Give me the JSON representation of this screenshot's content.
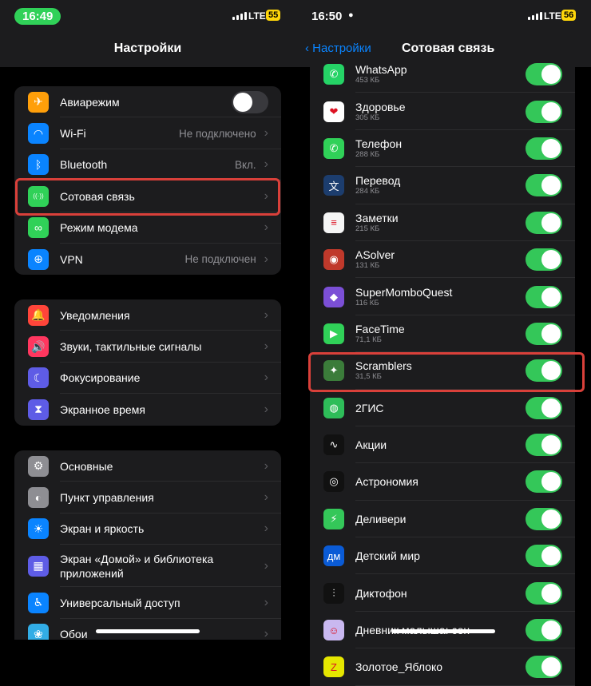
{
  "left": {
    "status": {
      "time": "16:49",
      "network": "LTE",
      "battery": "55"
    },
    "nav_title": "Настройки",
    "group1": [
      {
        "label": "Авиарежим",
        "value": "",
        "icon": "airplane-icon",
        "color": "#ff9f0a",
        "glyph": "✈",
        "toggle": "off"
      },
      {
        "label": "Wi‑Fi",
        "value": "Не подключено",
        "icon": "wifi-icon",
        "color": "#0a84ff",
        "glyph": "◠"
      },
      {
        "label": "Bluetooth",
        "value": "Вкл.",
        "icon": "bluetooth-icon",
        "color": "#0a84ff",
        "glyph": "ᛒ"
      },
      {
        "label": "Сотовая связь",
        "value": "",
        "icon": "cellular-icon",
        "color": "#30d158",
        "glyph": "((·))"
      },
      {
        "label": "Режим модема",
        "value": "",
        "icon": "hotspot-icon",
        "color": "#30d158",
        "glyph": "∞"
      },
      {
        "label": "VPN",
        "value": "Не подключен",
        "icon": "vpn-icon",
        "color": "#0a84ff",
        "glyph": "⊕"
      }
    ],
    "group2": [
      {
        "label": "Уведомления",
        "icon": "notifications-icon",
        "color": "#ff453a",
        "glyph": "🔔"
      },
      {
        "label": "Звуки, тактильные сигналы",
        "icon": "sounds-icon",
        "color": "#ff375f",
        "glyph": "🔊"
      },
      {
        "label": "Фокусирование",
        "icon": "focus-moon-icon",
        "color": "#5e5ce6",
        "glyph": "☾"
      },
      {
        "label": "Экранное время",
        "icon": "hourglass-icon",
        "color": "#5e5ce6",
        "glyph": "⧗"
      }
    ],
    "group3": [
      {
        "label": "Основные",
        "icon": "gear-icon",
        "color": "#8e8e93",
        "glyph": "⚙"
      },
      {
        "label": "Пункт управления",
        "icon": "control-center-icon",
        "color": "#8e8e93",
        "glyph": "◐"
      },
      {
        "label": "Экран и яркость",
        "icon": "brightness-icon",
        "color": "#0a84ff",
        "glyph": "☀"
      },
      {
        "label": "Экран «Домой» и библиотека приложений",
        "icon": "home-screen-icon",
        "color": "#5e5ce6",
        "glyph": "▦",
        "tall": true
      },
      {
        "label": "Универсальный доступ",
        "icon": "accessibility-icon",
        "color": "#0a84ff",
        "glyph": "♿"
      },
      {
        "label": "Обои",
        "icon": "wallpaper-icon",
        "color": "#32ade6",
        "glyph": "❀"
      }
    ]
  },
  "right": {
    "status": {
      "time": "16:50",
      "network": "LTE",
      "battery": "56"
    },
    "back_label": "Настройки",
    "nav_title": "Сотовая связь",
    "apps": [
      {
        "name": "WhatsApp",
        "size": "453 КБ",
        "icon": "whatsapp-icon",
        "color": "#25d366",
        "glyph": "✆"
      },
      {
        "name": "Здоровье",
        "size": "305 КБ",
        "icon": "health-heart-icon",
        "color": "#ffffff",
        "glyph": "❤"
      },
      {
        "name": "Телефон",
        "size": "288 КБ",
        "icon": "phone-icon",
        "color": "#30d158",
        "glyph": "✆"
      },
      {
        "name": "Перевод",
        "size": "284 КБ",
        "icon": "translate-icon",
        "color": "#1c3d6e",
        "glyph": "文"
      },
      {
        "name": "Заметки",
        "size": "215 КБ",
        "icon": "notes-icon",
        "color": "#f5f5f5",
        "glyph": "≡"
      },
      {
        "name": "ASolver",
        "size": "131 КБ",
        "icon": "asolver-icon",
        "color": "#c0392b",
        "glyph": "◉"
      },
      {
        "name": "SuperMomboQuest",
        "size": "116 КБ",
        "icon": "supermomboquest-icon",
        "color": "#7b4fd6",
        "glyph": "◆"
      },
      {
        "name": "FaceTime",
        "size": "71,1 КБ",
        "icon": "facetime-icon",
        "color": "#30d158",
        "glyph": "▶"
      },
      {
        "name": "Scramblers",
        "size": "31,5 КБ",
        "icon": "scramblers-icon",
        "color": "#3b7c3a",
        "glyph": "✦"
      },
      {
        "name": "2ГИС",
        "size": "",
        "icon": "2gis-icon",
        "color": "#2ebd59",
        "glyph": "◍"
      },
      {
        "name": "Акции",
        "size": "",
        "icon": "stocks-icon",
        "color": "#111111",
        "glyph": "∿"
      },
      {
        "name": "Астрономия",
        "size": "",
        "icon": "astronomy-icon",
        "color": "#111111",
        "glyph": "◎"
      },
      {
        "name": "Деливери",
        "size": "",
        "icon": "delivery-icon",
        "color": "#34c759",
        "glyph": "⚡"
      },
      {
        "name": "Детский мир",
        "size": "",
        "icon": "detsky-mir-icon",
        "color": "#0a5bd6",
        "glyph": "дм"
      },
      {
        "name": "Диктофон",
        "size": "",
        "icon": "voice-memos-icon",
        "color": "#111111",
        "glyph": "⫶"
      },
      {
        "name": "Дневник малыша: сон",
        "size": "",
        "icon": "baby-diary-icon",
        "color": "#c9b8f0",
        "glyph": "☺"
      },
      {
        "name": "Золотое_Яблоко",
        "size": "",
        "icon": "golden-apple-icon",
        "color": "#e5e600",
        "glyph": "Z"
      }
    ]
  }
}
